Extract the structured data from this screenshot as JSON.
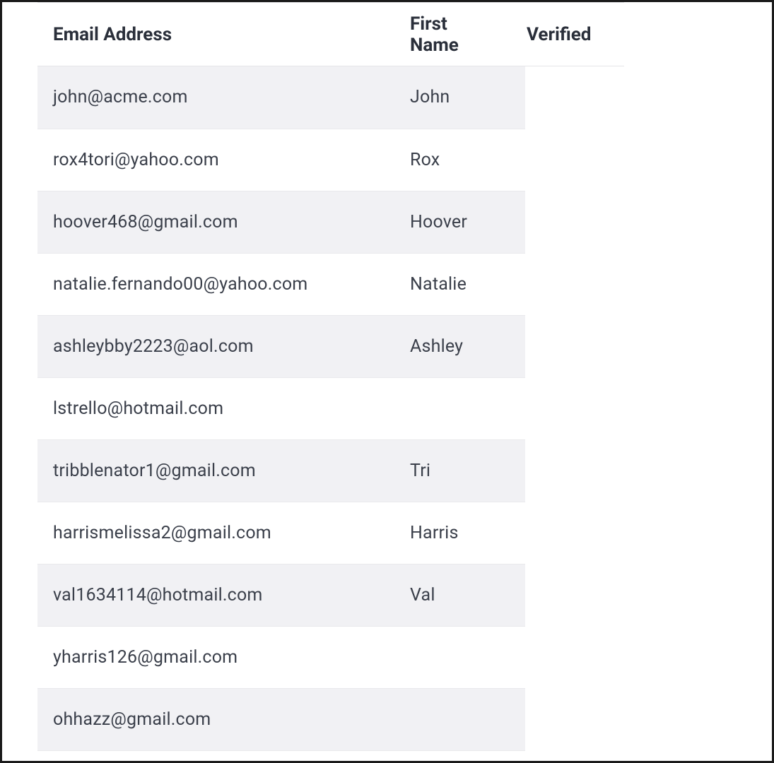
{
  "table": {
    "columns": {
      "email": "Email Address",
      "first_name": "First Name",
      "verified": "Verified"
    },
    "rows": [
      {
        "email": "john@acme.com",
        "first_name": "John"
      },
      {
        "email": "rox4tori@yahoo.com",
        "first_name": "Rox"
      },
      {
        "email": "hoover468@gmail.com",
        "first_name": "Hoover"
      },
      {
        "email": "natalie.fernando00@yahoo.com",
        "first_name": "Natalie"
      },
      {
        "email": "ashleybby2223@aol.com",
        "first_name": "Ashley"
      },
      {
        "email": "lstrello@hotmail.com",
        "first_name": ""
      },
      {
        "email": "tribblenator1@gmail.com",
        "first_name": "Tri"
      },
      {
        "email": "harrismelissa2@gmail.com",
        "first_name": "Harris"
      },
      {
        "email": "val1634114@hotmail.com",
        "first_name": "Val"
      },
      {
        "email": "yharris126@gmail.com",
        "first_name": ""
      },
      {
        "email": "ohhazz@gmail.com",
        "first_name": ""
      }
    ]
  }
}
